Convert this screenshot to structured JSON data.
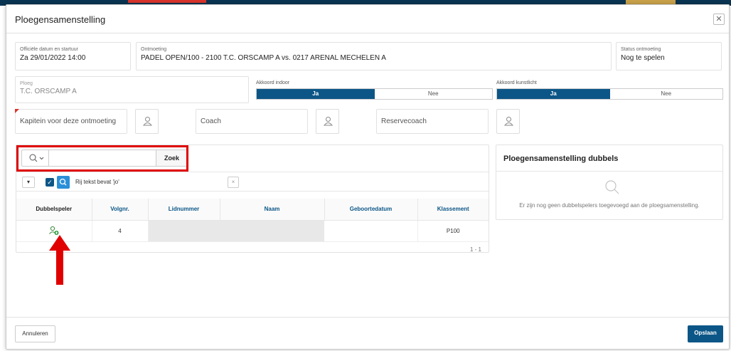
{
  "dialog": {
    "title": "Ploegensamenstelling",
    "close_icon": "close-icon"
  },
  "match": {
    "datetime_label": "Officiële datum en startuur",
    "datetime_value": "Za 29/01/2022 14:00",
    "meeting_label": "Ontmoeting",
    "meeting_value": "PADEL OPEN/100 - 2100 T.C. ORSCAMP A vs. 0217 ARENAL MECHELEN A",
    "status_label": "Status ontmoeting",
    "status_value": "Nog te spelen"
  },
  "team": {
    "label": "Ploeg",
    "value": "T.C. ORSCAMP A",
    "indoor_label": "Akkoord indoor",
    "indoor_options": [
      "Ja",
      "Nee"
    ],
    "indoor_selected": "Ja",
    "light_label": "Akkoord kunstlicht",
    "light_options": [
      "Ja",
      "Nee"
    ],
    "light_selected": "Ja"
  },
  "roles": {
    "captain_placeholder": "Kapitein voor deze ontmoeting",
    "coach_placeholder": "Coach",
    "reserve_placeholder": "Reservecoach"
  },
  "search": {
    "button_label": "Zoek",
    "value": ""
  },
  "filter": {
    "text": "Rij tekst bevat 'jo'",
    "remove_label": "×"
  },
  "table": {
    "columns": [
      "Dubbelspeler",
      "Volgnr.",
      "Lidnummer",
      "Naam",
      "Geboortedatum",
      "Klassement"
    ],
    "rows": [
      {
        "volgnr": "4",
        "lidnummer": "",
        "naam": "",
        "geboortedatum": "",
        "klassement": "P100"
      }
    ],
    "pagination": "1 - 1"
  },
  "doubles": {
    "title": "Ploegensamenstelling dubbels",
    "empty_message": "Er zijn nog geen dubbelspelers toegevoegd aan de ploegsamenstelling."
  },
  "footer": {
    "cancel_label": "Annuleren",
    "save_label": "Opslaan"
  },
  "colors": {
    "primary": "#0c5687",
    "highlight": "#e00000"
  }
}
